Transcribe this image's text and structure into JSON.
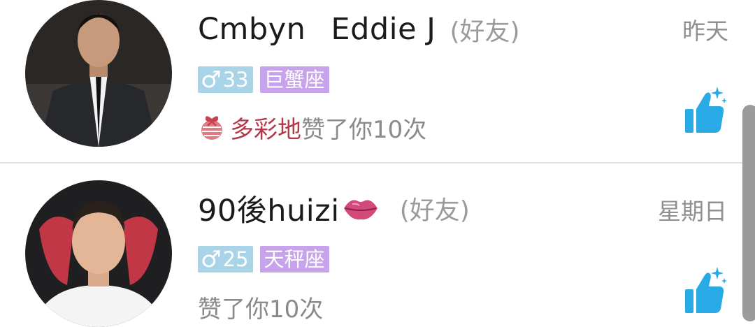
{
  "items": [
    {
      "name_part1": "Cmbyn",
      "name_part2": "Eddie J",
      "friend_tag": "(好友)",
      "time": "昨天",
      "gender_symbol": "♂",
      "age": "33",
      "zodiac": "巨蟹座",
      "sender": "多彩地",
      "like_text": "赞了你10次",
      "gift_icon": "gift-bow-icon",
      "action_icon": "thumbs-up-sparkle-icon"
    },
    {
      "name": "90後huizi",
      "name_emoji_icon": "lips-kiss-icon",
      "friend_tag": "(好友)",
      "time": "星期日",
      "gender_symbol": "♂",
      "age": "25",
      "zodiac": "天秤座",
      "like_text": "赞了你10次",
      "action_icon": "thumbs-up-sparkle-icon"
    }
  ],
  "colors": {
    "gender_badge": "#a9d4e8",
    "zodiac_badge": "#c6a3ea",
    "sender": "#b5374a",
    "like_icon": "#29a9e6",
    "muted_text": "#8a8a8a"
  }
}
